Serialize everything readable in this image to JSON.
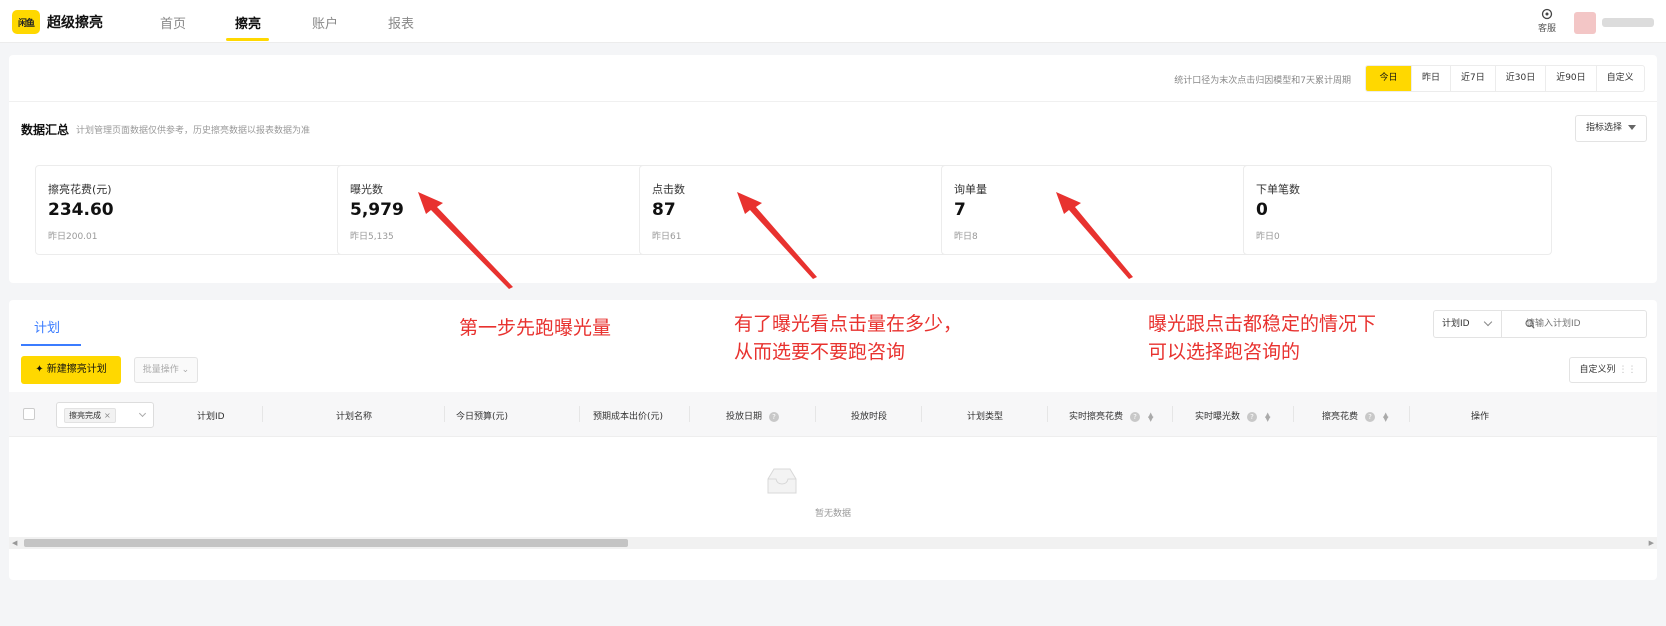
{
  "app": {
    "logo_badge": "闲鱼",
    "name": "超级擦亮"
  },
  "nav": {
    "items": [
      "首页",
      "擦亮",
      "账户",
      "报表"
    ],
    "active": "擦亮"
  },
  "header": {
    "support_label": "客服"
  },
  "summary": {
    "caliber_note": "统计口径为末次点击归因模型和7天累计周期",
    "date_tabs": [
      "今日",
      "昨日",
      "近7日",
      "近30日",
      "近90日",
      "自定义"
    ],
    "active_date_tab": "今日",
    "title": "数据汇总",
    "note": "计划管理页面数据仅供参考，历史擦亮数据以报表数据为准",
    "metric_select_label": "指标选择",
    "metrics": [
      {
        "label": "擦亮花费(元)",
        "value": "234.60",
        "yesterday": "昨日200.01"
      },
      {
        "label": "曝光数",
        "value": "5,979",
        "yesterday": "昨日5,135"
      },
      {
        "label": "点击数",
        "value": "87",
        "yesterday": "昨日61"
      },
      {
        "label": "询单量",
        "value": "7",
        "yesterday": "昨日8"
      },
      {
        "label": "下单笔数",
        "value": "0",
        "yesterday": "昨日0"
      }
    ]
  },
  "plans": {
    "tab_label": "计划",
    "filter_type": "计划ID",
    "search_placeholder": "请输入计划ID",
    "new_plan_label": "✦ 新建擦亮计划",
    "batch_label": "批量操作",
    "custom_columns_label": "自定义列",
    "status_tag": "擦亮完成",
    "columns": [
      "计划ID",
      "计划名称",
      "今日预算(元)",
      "预期成本出价(元)",
      "投放日期",
      "投放时段",
      "计划类型",
      "实时擦亮花费",
      "实时曝光数",
      "擦亮花费",
      "操作"
    ],
    "empty_text": "暂无数据"
  },
  "annotations": {
    "step1": "第一步先跑曝光量",
    "step2_line1": "有了曝光看点击量在多少，",
    "step2_line2": "从而选要不要跑咨询",
    "step3_line1": "曝光跟点击都稳定的情况下",
    "step3_line2": "可以选择跑咨询的"
  },
  "colors": {
    "brand_yellow": "#ffd800",
    "link_blue": "#3b7cff",
    "annotation_red": "#e8322f"
  }
}
